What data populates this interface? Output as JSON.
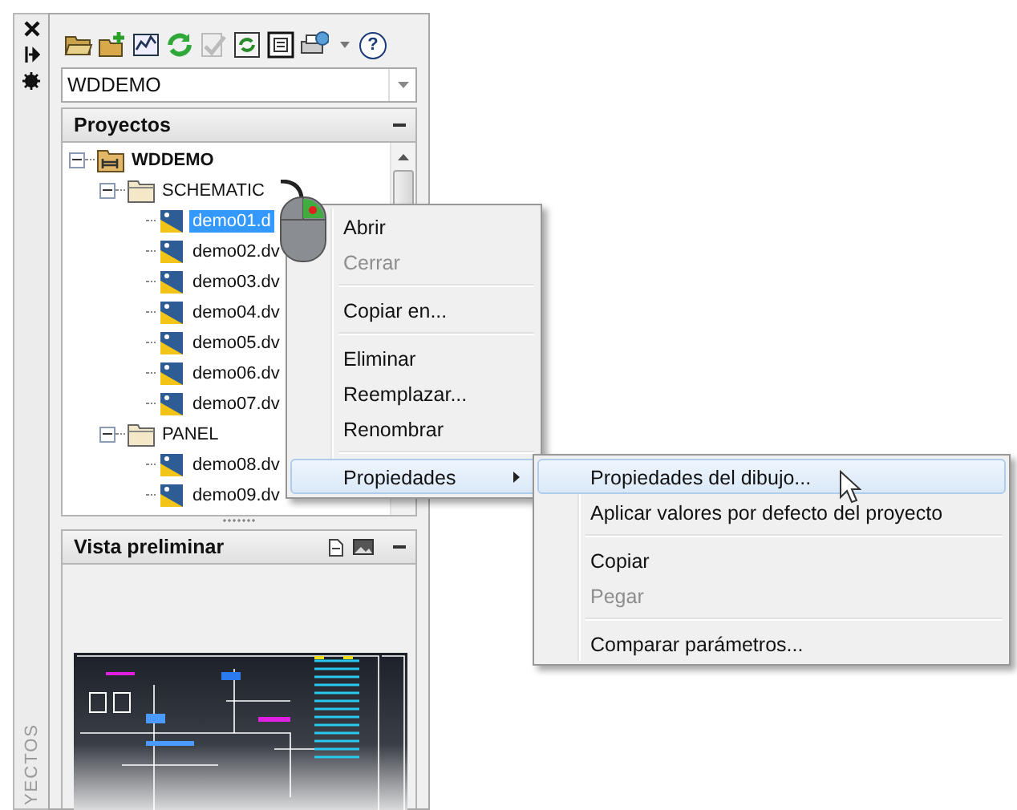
{
  "side_strip": {
    "label": "YECTOS"
  },
  "toolbar": {
    "help_label": "?"
  },
  "project_combo": {
    "value": "WDDEMO"
  },
  "projects_panel": {
    "title": "Proyectos",
    "tree": [
      {
        "label": "WDDEMO",
        "kind": "project",
        "expanded": true,
        "selected": false,
        "children": [
          {
            "label": "SCHEMATIC",
            "kind": "folder",
            "expanded": true,
            "selected": false,
            "children": [
              {
                "label": "demo01.d",
                "kind": "drawing",
                "selected": true
              },
              {
                "label": "demo02.dv",
                "kind": "drawing",
                "selected": false
              },
              {
                "label": "demo03.dv",
                "kind": "drawing",
                "selected": false
              },
              {
                "label": "demo04.dv",
                "kind": "drawing",
                "selected": false
              },
              {
                "label": "demo05.dv",
                "kind": "drawing",
                "selected": false
              },
              {
                "label": "demo06.dv",
                "kind": "drawing",
                "selected": false
              },
              {
                "label": "demo07.dv",
                "kind": "drawing",
                "selected": false
              }
            ]
          },
          {
            "label": "PANEL",
            "kind": "folder",
            "expanded": true,
            "selected": false,
            "children": [
              {
                "label": "demo08.dv",
                "kind": "drawing",
                "selected": false
              },
              {
                "label": "demo09.dv",
                "kind": "drawing",
                "selected": false
              }
            ]
          }
        ]
      }
    ]
  },
  "preview_panel": {
    "title": "Vista preliminar"
  },
  "context_menu": {
    "items": [
      {
        "kind": "item",
        "label": "Abrir",
        "disabled": false,
        "selected": false
      },
      {
        "kind": "item",
        "label": "Cerrar",
        "disabled": true,
        "selected": false
      },
      {
        "kind": "separator"
      },
      {
        "kind": "item",
        "label": "Copiar en...",
        "disabled": false,
        "selected": false
      },
      {
        "kind": "separator"
      },
      {
        "kind": "item",
        "label": "Eliminar",
        "disabled": false,
        "selected": false
      },
      {
        "kind": "item",
        "label": "Reemplazar...",
        "disabled": false,
        "selected": false
      },
      {
        "kind": "item",
        "label": "Renombrar",
        "disabled": false,
        "selected": false
      },
      {
        "kind": "separator"
      },
      {
        "kind": "submenu",
        "label": "Propiedades",
        "disabled": false,
        "selected": true
      }
    ]
  },
  "submenu": {
    "items": [
      {
        "kind": "item",
        "label": "Propiedades del dibujo...",
        "disabled": false,
        "selected": true
      },
      {
        "kind": "item",
        "label": "Aplicar valores por defecto del proyecto",
        "disabled": false,
        "selected": false
      },
      {
        "kind": "separator"
      },
      {
        "kind": "item",
        "label": "Copiar",
        "disabled": false,
        "selected": false
      },
      {
        "kind": "item",
        "label": "Pegar",
        "disabled": true,
        "selected": false
      },
      {
        "kind": "separator"
      },
      {
        "kind": "item",
        "label": "Comparar parámetros...",
        "disabled": false,
        "selected": false
      }
    ]
  }
}
